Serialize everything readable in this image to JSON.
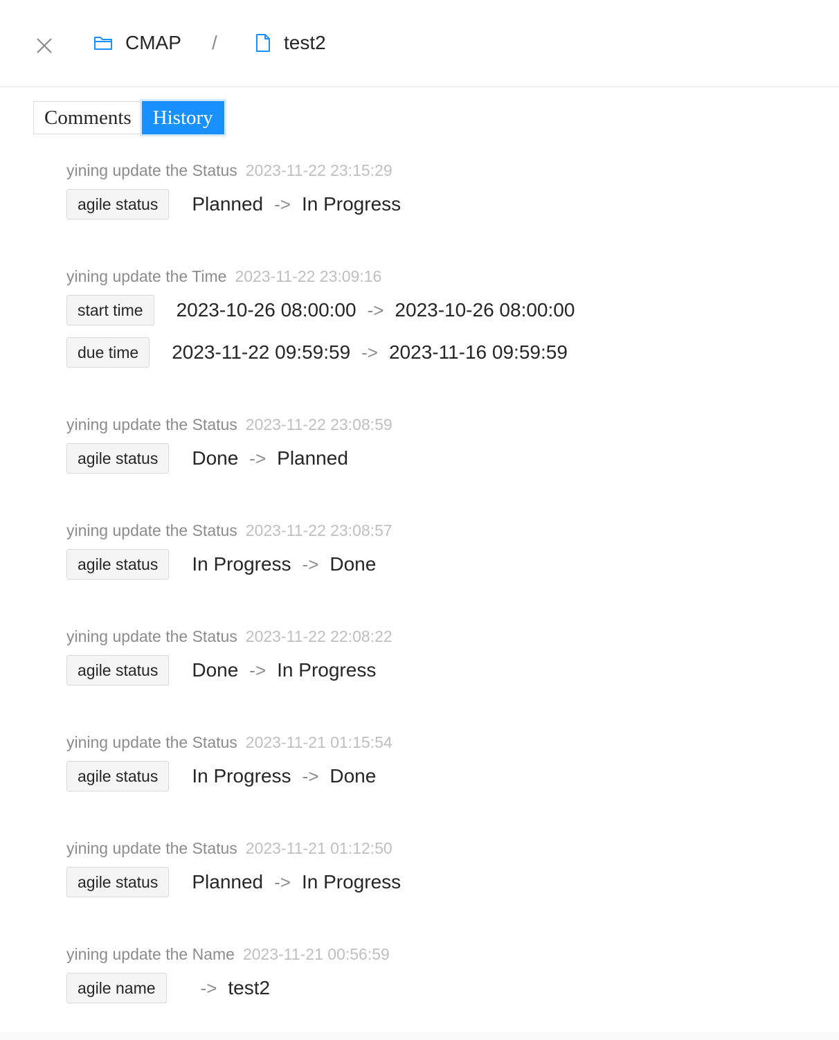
{
  "breadcrumb": {
    "folder_label": "CMAP",
    "separator": "/",
    "file_label": "test2"
  },
  "tabs": [
    {
      "label": "Comments",
      "active": false
    },
    {
      "label": "History",
      "active": true
    }
  ],
  "history": [
    {
      "summary": "yining update the Status",
      "timestamp": "2023-11-22 23:15:29",
      "changes": [
        {
          "field": "agile status",
          "old": "Planned",
          "arrow": "->",
          "new": "In Progress"
        }
      ]
    },
    {
      "summary": "yining update the Time",
      "timestamp": "2023-11-22 23:09:16",
      "changes": [
        {
          "field": "start time",
          "old": "2023-10-26 08:00:00",
          "arrow": "->",
          "new": "2023-10-26 08:00:00"
        },
        {
          "field": "due time",
          "old": "2023-11-22 09:59:59",
          "arrow": "->",
          "new": "2023-11-16 09:59:59"
        }
      ]
    },
    {
      "summary": "yining update the Status",
      "timestamp": "2023-11-22 23:08:59",
      "changes": [
        {
          "field": "agile status",
          "old": "Done",
          "arrow": "->",
          "new": "Planned"
        }
      ]
    },
    {
      "summary": "yining update the Status",
      "timestamp": "2023-11-22 23:08:57",
      "changes": [
        {
          "field": "agile status",
          "old": "In Progress",
          "arrow": "->",
          "new": "Done"
        }
      ]
    },
    {
      "summary": "yining update the Status",
      "timestamp": "2023-11-22 22:08:22",
      "changes": [
        {
          "field": "agile status",
          "old": "Done",
          "arrow": "->",
          "new": "In Progress"
        }
      ]
    },
    {
      "summary": "yining update the Status",
      "timestamp": "2023-11-21 01:15:54",
      "changes": [
        {
          "field": "agile status",
          "old": "In Progress",
          "arrow": "->",
          "new": "Done"
        }
      ]
    },
    {
      "summary": "yining update the Status",
      "timestamp": "2023-11-21 01:12:50",
      "changes": [
        {
          "field": "agile status",
          "old": "Planned",
          "arrow": "->",
          "new": "In Progress"
        }
      ]
    },
    {
      "summary": "yining update the Name",
      "timestamp": "2023-11-21 00:56:59",
      "changes": [
        {
          "field": "agile name",
          "old": "",
          "arrow": "->",
          "new": "test2"
        }
      ]
    }
  ],
  "colors": {
    "accent": "#1890ff",
    "timestamp": "#bfbfbf",
    "summary": "#8c8c8c"
  }
}
